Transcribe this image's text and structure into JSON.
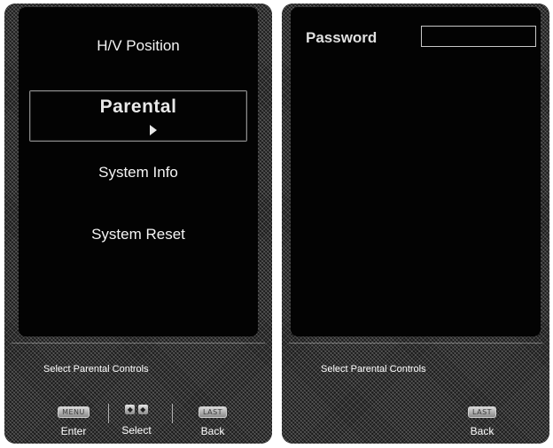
{
  "left_screen": {
    "menu_items": [
      "H/V Position",
      "Parental",
      "System Info",
      "System Reset"
    ],
    "selected_index": 1,
    "hint": "Select Parental Controls",
    "buttons": {
      "enter": {
        "key": "MENU",
        "label": "Enter"
      },
      "select": {
        "keys": [
          "◆",
          "◆"
        ],
        "label": "Select"
      },
      "back": {
        "key": "LAST",
        "label": "Back"
      }
    }
  },
  "right_screen": {
    "password_label": "Password",
    "password_value": "",
    "hint": "Select Parental Controls",
    "buttons": {
      "back": {
        "key": "LAST",
        "label": "Back"
      }
    }
  },
  "icons": {
    "selection_pointer": "arrow-right-icon",
    "select_keys": [
      "left-right-arrows-icon",
      "up-down-arrows-icon"
    ]
  },
  "colors": {
    "screen_background": "#030303",
    "text": "#f4f4f4",
    "bezel": "#1b1b1b"
  }
}
